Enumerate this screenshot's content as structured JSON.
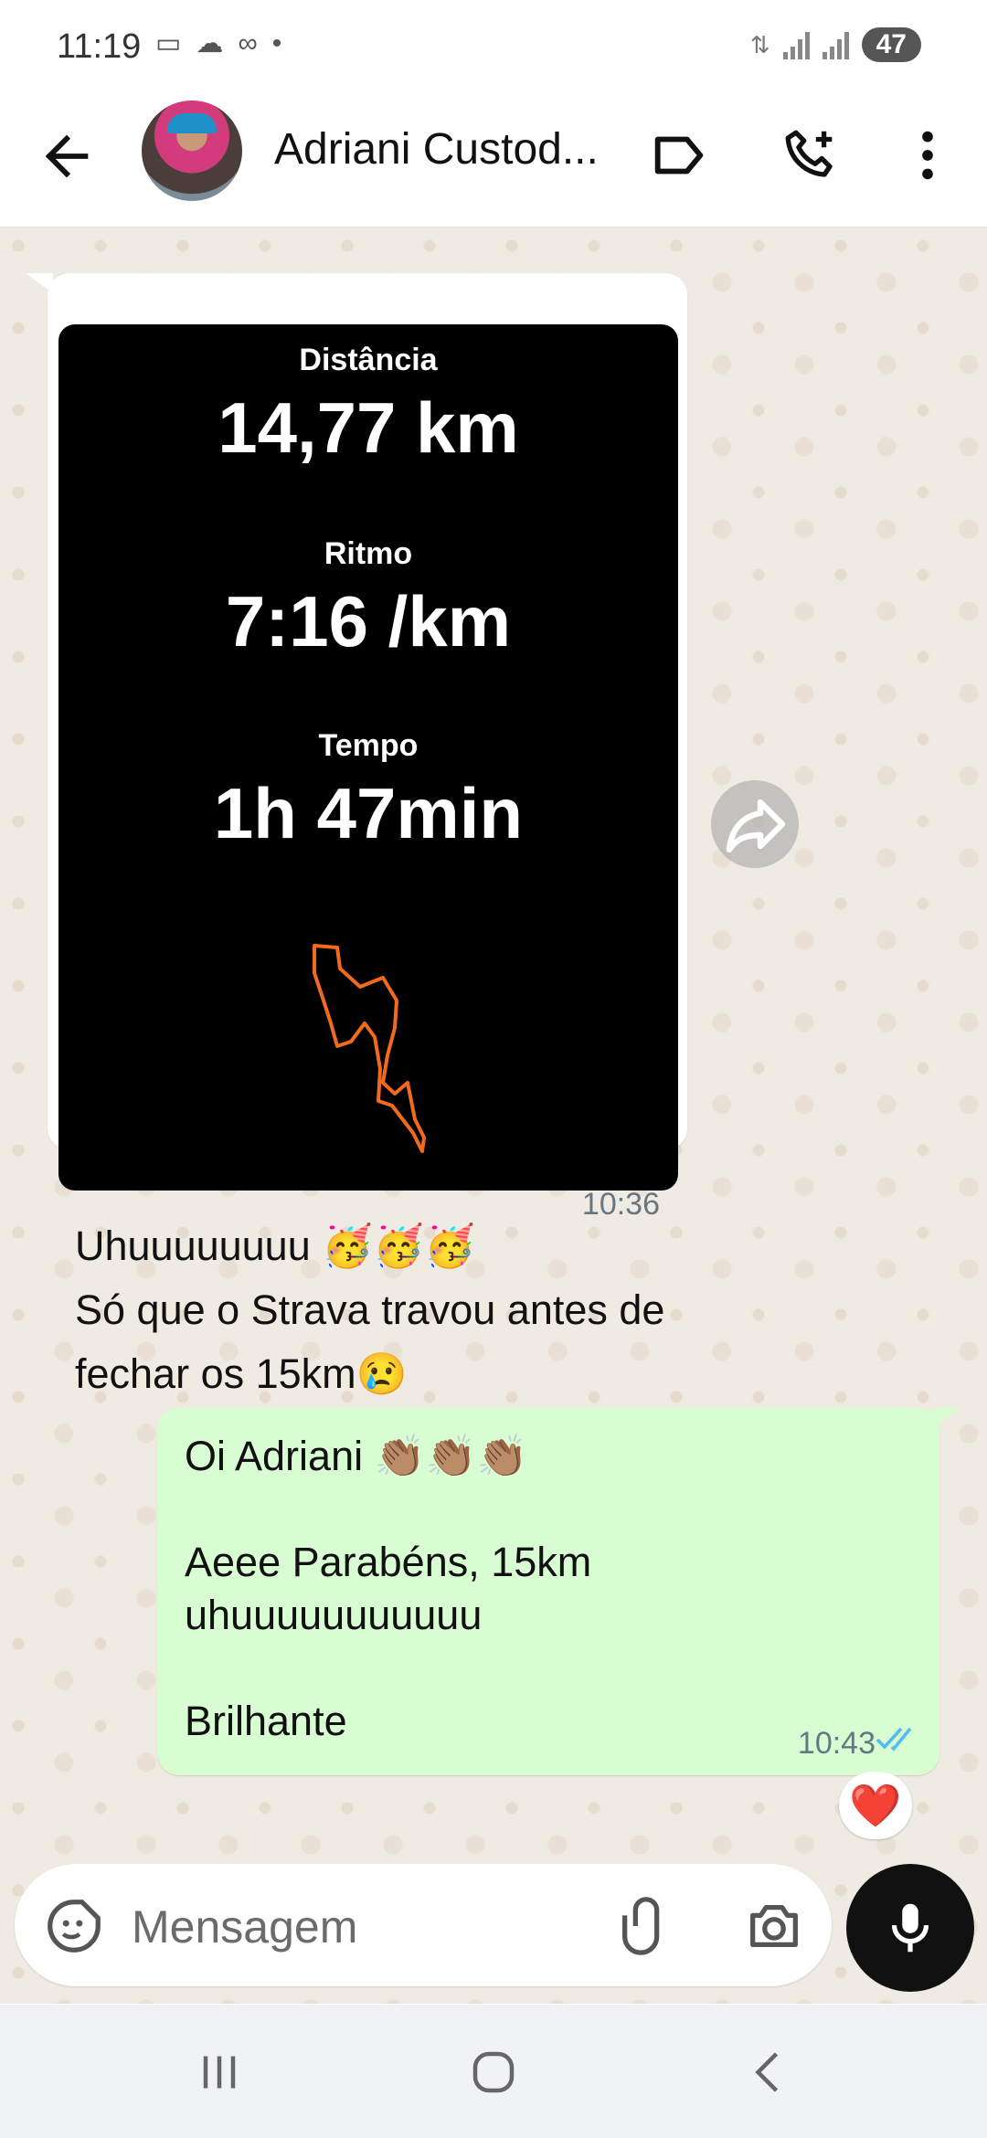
{
  "status_bar": {
    "time": "11:19",
    "battery": "47",
    "extra_dot": "•"
  },
  "header": {
    "contact_name": "Adriani Custod...",
    "icons": [
      "back-arrow-icon",
      "label-tag-icon",
      "add-call-icon",
      "more-vert-icon"
    ]
  },
  "incoming": {
    "image_card": {
      "distance_label": "Distância",
      "distance_value": "14,77 km",
      "pace_label": "Ritmo",
      "pace_value": "7:16 /km",
      "time_label": "Tempo",
      "time_value": "1h 47min",
      "route_color": "#f26b1d"
    },
    "caption_line1": "Uhuuuuuuuu 🥳🥳🥳",
    "caption_line2": "Só que o Strava travou antes de fechar os 15km😢",
    "time": "10:36"
  },
  "outgoing": {
    "line1": "Oi Adriani 👏🏽👏🏽👏🏽",
    "line2": "Aeee Parabéns, 15km uhuuuuuuuuuuu",
    "line3": "Brilhante",
    "time": "10:43",
    "read_tick_color": "#53bdeb",
    "reaction": "❤️"
  },
  "composer": {
    "placeholder": "Mensagem"
  },
  "colors": {
    "chat_bg": "#efeae2",
    "out_bubble": "#d9fdd3",
    "in_bubble": "#ffffff"
  }
}
